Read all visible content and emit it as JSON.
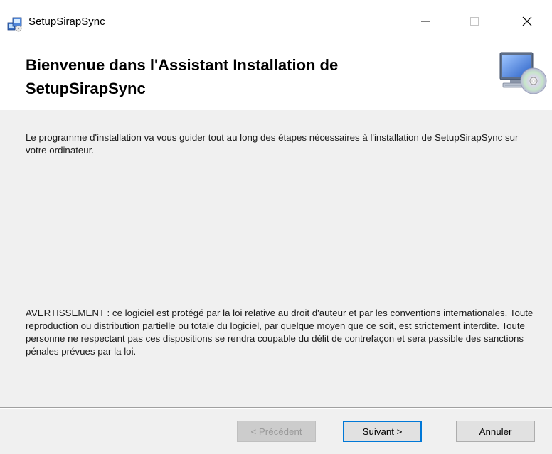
{
  "window": {
    "title": "SetupSirapSync",
    "minimize_icon": "minimize-icon",
    "maximize_icon": "maximize-icon",
    "close_icon": "close-icon"
  },
  "header": {
    "title": "Bienvenue dans l'Assistant Installation de SetupSirapSync",
    "icon": "computer-cd-icon"
  },
  "content": {
    "intro": "Le programme d'installation va vous guider tout au long des étapes nécessaires à l'installation de SetupSirapSync sur votre ordinateur.",
    "warning": "AVERTISSEMENT : ce logiciel est protégé par la loi relative au droit d'auteur et par les conventions internationales. Toute reproduction ou distribution partielle ou totale du logiciel, par quelque moyen que ce soit, est strictement interdite. Toute personne ne respectant pas ces dispositions se rendra coupable du délit de contrefaçon et sera passible des sanctions pénales prévues par la loi."
  },
  "footer": {
    "prev_label": "< Précédent",
    "next_label": "Suivant >",
    "cancel_label": "Annuler",
    "prev_enabled": false
  },
  "colors": {
    "accent": "#0078d7",
    "panel_bg": "#f0f0f0",
    "button_bg": "#e1e1e1"
  }
}
